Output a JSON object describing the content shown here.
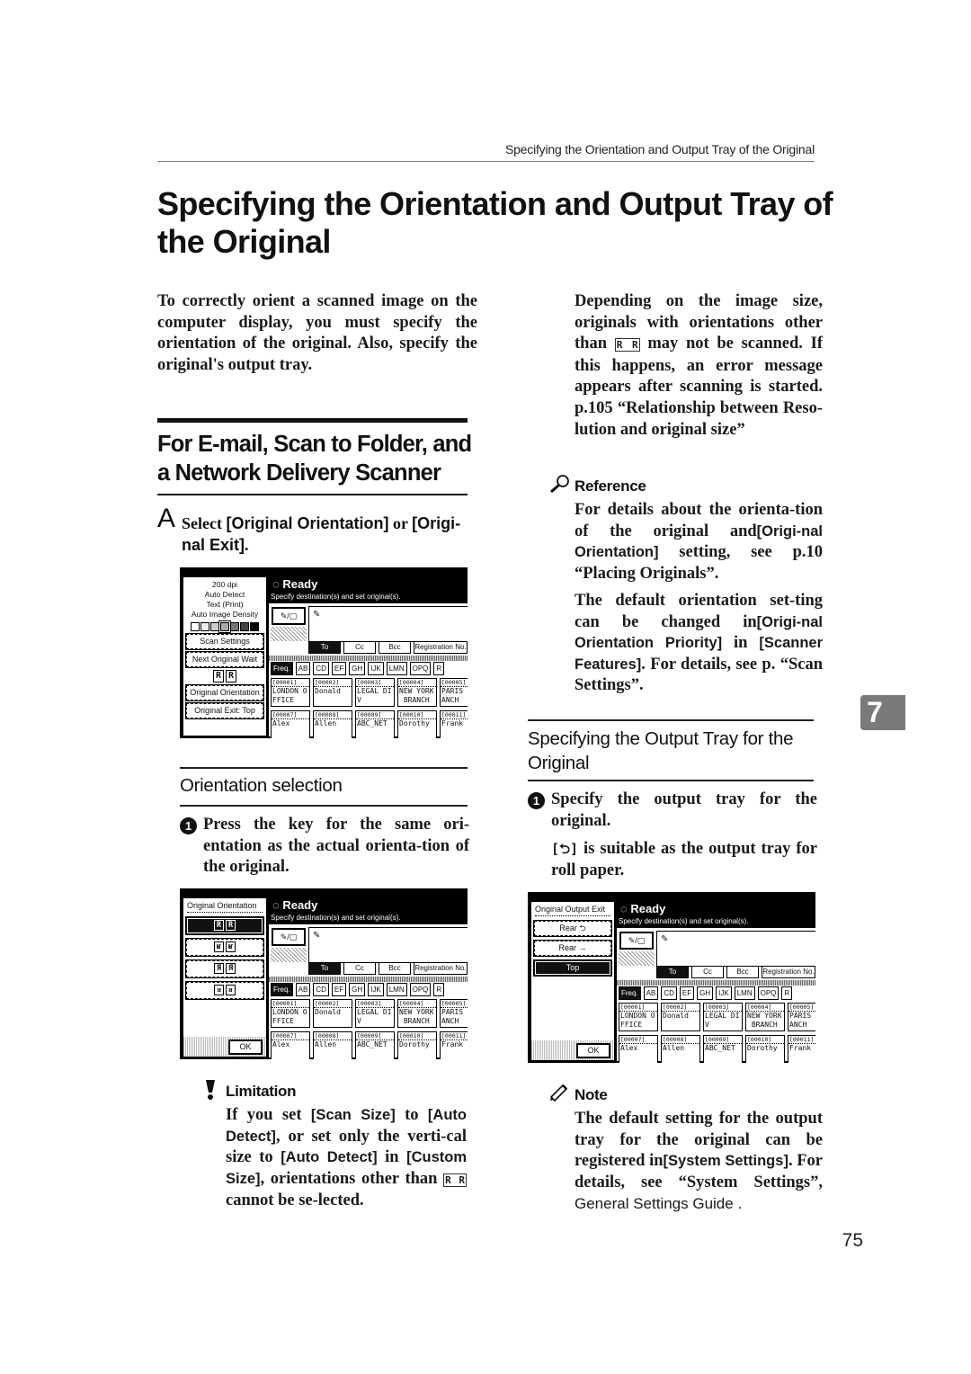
{
  "running_head": "Specifying the Orientation and Output Tray of the Original",
  "page_title": "Specifying the Orientation and Output Tray of the Original",
  "intro": "To correctly orient a scanned image on the computer display, you must specify the orientation of the original. Also, specify the original's output tray.",
  "section": {
    "title_line1": "For E-mail, Scan to Folder, and",
    "title_line2": "a Network Delivery Scanner"
  },
  "step_a": {
    "letter": "A",
    "pre": "Select ",
    "k1": "[Original Orientation]",
    "mid": " or ",
    "k2": "[Origi-nal Exit]",
    "post": "."
  },
  "orientation_selection": {
    "heading": "Orientation selection",
    "bullet": "1",
    "step": "Press the key for the same ori-entation as the actual orienta-tion of the original."
  },
  "limitation": {
    "label": "Limitation",
    "t1": "If you set ",
    "k1": "[Scan Size]",
    "t2": " to ",
    "k2": "[Auto Detect]",
    "t3": ", or set only the verti-cal size to ",
    "k3": "[Auto Detect]",
    "t4": " in ",
    "k4": "[Custom Size]",
    "t5": ", orientations other than ",
    "glyph": "R R",
    "t6": " cannot be se-lected."
  },
  "right_col": {
    "depending": {
      "t1": "Depending on the image size, originals with orientations other than ",
      "glyph": "R R",
      "t2": " may not be scanned. If this happens, an error message appears after scanning is started. ",
      "ref": "p.105 “Relationship between Reso-lution and original size”"
    },
    "reference": {
      "label": "Reference",
      "p1_t1": "For details about the orienta-tion of the original and",
      "p1_k1": "[Origi-nal Orientation]",
      "p1_t2": " setting, see p.10 “Placing Originals”.",
      "p2_t1": "The default orientation set-ting can be changed in",
      "p2_k1": "[Origi-nal Orientation Priority]",
      "p2_t2": " in ",
      "p2_k2": "[Scanner Features]",
      "p2_t3": ". For details, see p.  “Scan Settings”."
    },
    "output_tray": {
      "heading_line1": "Specifying the Output Tray for the",
      "heading_line2": "Original",
      "bullet": "1",
      "step": "Specify the output tray for the original.",
      "sub_glyph": "[⮌]",
      "sub_text": " is suitable as the output tray for roll paper."
    },
    "note": {
      "label": "Note",
      "t1": "The default setting for the output tray for the original can be registered in",
      "k1": "[System Settings]",
      "t2": ". For details, see “System Settings”, ",
      "t3": "General Settings Guide ."
    }
  },
  "chapter_tab": "7",
  "page_number": "75",
  "panel_common": {
    "ready": "Ready",
    "hint": "Specify destination(s) and set original(s).",
    "dest_toggle": "✎/▢",
    "dest_field_icon": "✎",
    "tabs": [
      "To",
      "Cc",
      "Bcc",
      "Registration No."
    ],
    "index_tabs": [
      "Freq.",
      "AB",
      "CD",
      "EF",
      "GH",
      "IJK",
      "LMN",
      "OPQ",
      "R"
    ],
    "cards": [
      {
        "id": "[00001]",
        "name": "LONDON O\nFFICE"
      },
      {
        "id": "[00002]",
        "name": "Donald"
      },
      {
        "id": "[00003]",
        "name": "LEGAL DI\nV"
      },
      {
        "id": "[00004]",
        "name": "NEW YORK\n BRANCH"
      },
      {
        "id": "[00005]",
        "name": "PARIS\nANCH"
      },
      {
        "id": "[00007]",
        "name": "Alex"
      },
      {
        "id": "[00008]",
        "name": "Allen"
      },
      {
        "id": "[00009]",
        "name": "ABC_NET"
      },
      {
        "id": "[00010]",
        "name": "Dorothy"
      },
      {
        "id": "[00011]",
        "name": "Frank"
      }
    ]
  },
  "panel1": {
    "info": [
      "200 dpi",
      "Auto Detect",
      "Text (Print)",
      "Auto Image Density"
    ],
    "density_levels": 7,
    "density_selected_index": 3,
    "buttons": {
      "scan_settings": "Scan Settings",
      "next_original_wait": "Next Original Wait",
      "original_orientation": "Original Orientation",
      "original_exit": "Original Exit: Top"
    },
    "orientation_glyph": [
      "R",
      "R"
    ]
  },
  "panel2": {
    "title": "Original Orientation",
    "options": [
      {
        "glyph": [
          "R",
          "R"
        ],
        "selected": true
      },
      {
        "glyph": [
          "ʁ",
          "ʁ"
        ],
        "selected": false
      },
      {
        "glyph": [
          "Я",
          "Я"
        ],
        "selected": false
      },
      {
        "glyph": [
          "ᴚ",
          "ᴚ"
        ],
        "selected": false
      }
    ],
    "ok": "OK"
  },
  "panel3": {
    "title": "Original Output Exit",
    "options": [
      {
        "label": "Rear ⮌",
        "selected": false
      },
      {
        "label": "Rear →",
        "selected": false
      },
      {
        "label": "Top",
        "selected": true
      }
    ],
    "ok": "OK"
  }
}
